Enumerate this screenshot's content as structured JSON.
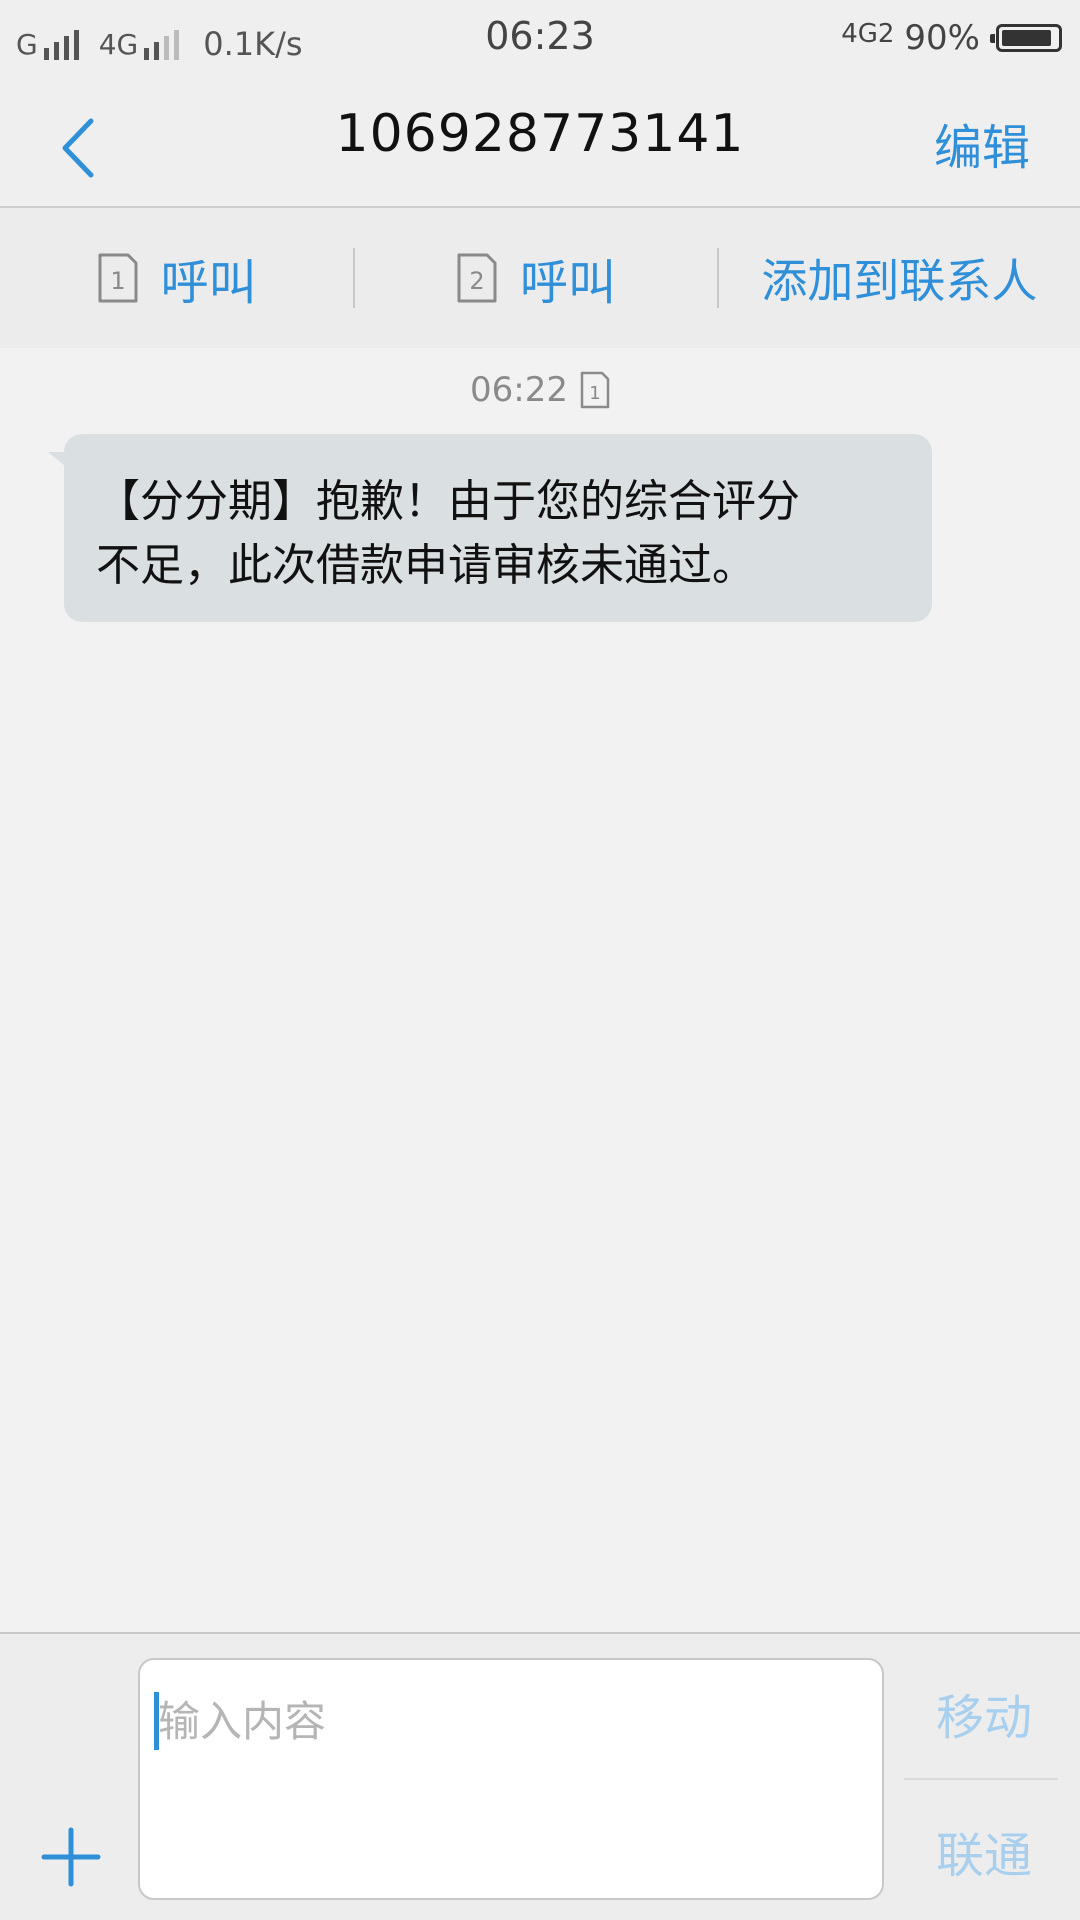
{
  "status_bar": {
    "network_1": "G",
    "network_2": "4G",
    "speed": "0.1K/s",
    "time": "06:23",
    "data_indicator": "4G2",
    "battery_percent": "90%",
    "battery_level": 0.9
  },
  "header": {
    "title": "106928773141",
    "edit_label": "编辑"
  },
  "actions": {
    "call_sim1_label": "呼叫",
    "sim1_number": "1",
    "call_sim2_label": "呼叫",
    "sim2_number": "2",
    "add_contact_label": "添加到联系人"
  },
  "conversation": {
    "timestamp": "06:22",
    "timestamp_sim": "1",
    "message_line1": "【分分期】抱歉！由于您的综合评分",
    "message_line2": "不足，此次借款申请审核未通过。"
  },
  "compose": {
    "placeholder": "输入内容",
    "send_sim1_label": "移动",
    "send_sim2_label": "联通"
  },
  "colors": {
    "accent": "#2f8fd8",
    "accent_disabled": "#a9cfee",
    "bubble": "#dadfe2",
    "background": "#f2f2f2"
  }
}
